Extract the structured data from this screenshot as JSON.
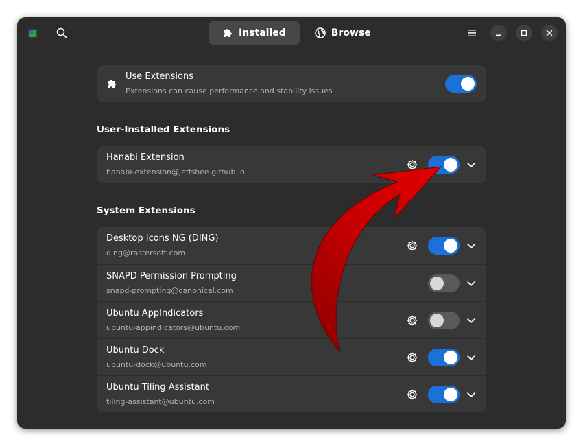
{
  "header": {
    "tabs": [
      {
        "label": "Installed",
        "icon": "puzzle-icon",
        "active": true
      },
      {
        "label": "Browse",
        "icon": "globe-icon",
        "active": false
      }
    ]
  },
  "use_extensions": {
    "title": "Use Extensions",
    "subtitle": "Extensions can cause performance and stability issues",
    "enabled": true
  },
  "user_section": {
    "title": "User-Installed Extensions",
    "items": [
      {
        "name": "Hanabi Extension",
        "id": "hanabi-extension@jeffshee.github.io",
        "enabled": true,
        "has_settings": true
      }
    ]
  },
  "system_section": {
    "title": "System Extensions",
    "items": [
      {
        "name": "Desktop Icons NG (DING)",
        "id": "ding@rastersoft.com",
        "enabled": true,
        "has_settings": true
      },
      {
        "name": "SNAPD Permission Prompting",
        "id": "snapd-prompting@canonical.com",
        "enabled": false,
        "has_settings": false
      },
      {
        "name": "Ubuntu AppIndicators",
        "id": "ubuntu-appindicators@ubuntu.com",
        "enabled": false,
        "has_settings": true
      },
      {
        "name": "Ubuntu Dock",
        "id": "ubuntu-dock@ubuntu.com",
        "enabled": true,
        "has_settings": true
      },
      {
        "name": "Ubuntu Tiling Assistant",
        "id": "tiling-assistant@ubuntu.com",
        "enabled": true,
        "has_settings": true
      }
    ]
  },
  "colors": {
    "accent": "#1c71d8",
    "window_bg": "#2c2c2c",
    "card_bg": "#383838",
    "annotation_arrow": "#c00000"
  }
}
